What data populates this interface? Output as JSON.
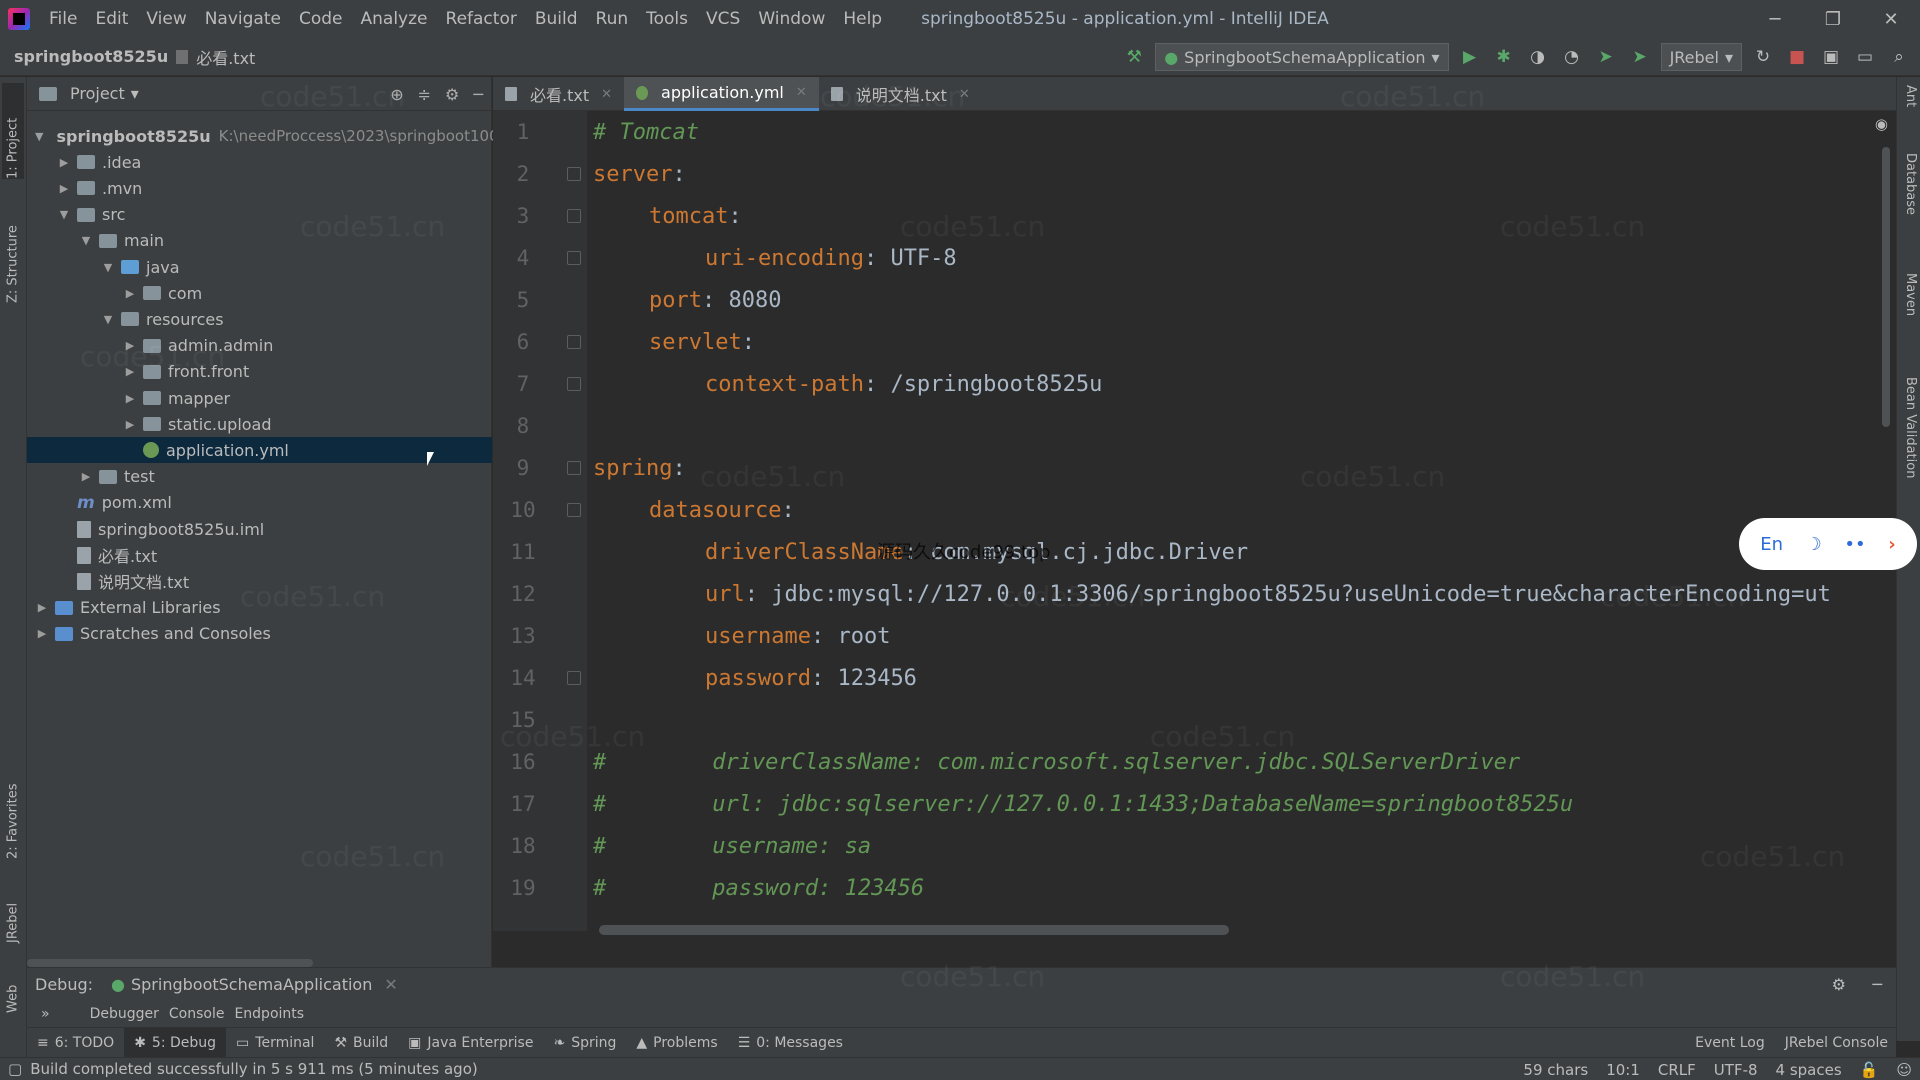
{
  "menu": [
    "File",
    "Edit",
    "View",
    "Navigate",
    "Code",
    "Analyze",
    "Refactor",
    "Build",
    "Run",
    "Tools",
    "VCS",
    "Window",
    "Help"
  ],
  "window_title": "springboot8525u - application.yml - IntelliJ IDEA",
  "breadcrumb": {
    "project": "springboot8525u",
    "file": "必看.txt"
  },
  "toolbar": {
    "run_config": "SpringbootSchemaApplication",
    "jrebel": "JRebel"
  },
  "left_tabs": [
    "1: Project",
    "Z: Structure",
    "2: Favorites",
    "JRebel",
    "Web"
  ],
  "right_tabs": [
    "Ant",
    "Database",
    "Maven",
    "Bean Validation"
  ],
  "project_panel": {
    "title": "Project",
    "root_path": "K:\\needProccess\\2023\\springboot100",
    "tree": [
      {
        "label": "springboot8525u",
        "depth": 0,
        "arrow": "▼",
        "icon": "folder"
      },
      {
        "label": ".idea",
        "depth": 1,
        "arrow": "▶",
        "icon": "folder"
      },
      {
        "label": ".mvn",
        "depth": 1,
        "arrow": "▶",
        "icon": "folder"
      },
      {
        "label": "src",
        "depth": 1,
        "arrow": "▼",
        "icon": "folder"
      },
      {
        "label": "main",
        "depth": 2,
        "arrow": "▼",
        "icon": "folder"
      },
      {
        "label": "java",
        "depth": 3,
        "arrow": "▼",
        "icon": "folder-blue"
      },
      {
        "label": "com",
        "depth": 4,
        "arrow": "▶",
        "icon": "folder"
      },
      {
        "label": "resources",
        "depth": 3,
        "arrow": "▼",
        "icon": "folder"
      },
      {
        "label": "admin.admin",
        "depth": 4,
        "arrow": "▶",
        "icon": "folder"
      },
      {
        "label": "front.front",
        "depth": 4,
        "arrow": "▶",
        "icon": "folder"
      },
      {
        "label": "mapper",
        "depth": 4,
        "arrow": "▶",
        "icon": "folder"
      },
      {
        "label": "static.upload",
        "depth": 4,
        "arrow": "▶",
        "icon": "folder"
      },
      {
        "label": "application.yml",
        "depth": 4,
        "arrow": "",
        "icon": "yml",
        "selected": true
      },
      {
        "label": "test",
        "depth": 2,
        "arrow": "▶",
        "icon": "folder"
      },
      {
        "label": "pom.xml",
        "depth": 1,
        "arrow": "",
        "icon": "maven"
      },
      {
        "label": "springboot8525u.iml",
        "depth": 1,
        "arrow": "",
        "icon": "file"
      },
      {
        "label": "必看.txt",
        "depth": 1,
        "arrow": "",
        "icon": "file"
      },
      {
        "label": "说明文档.txt",
        "depth": 1,
        "arrow": "",
        "icon": "file"
      },
      {
        "label": "External Libraries",
        "depth": 0,
        "arrow": "▶",
        "icon": "ext"
      },
      {
        "label": "Scratches and Consoles",
        "depth": 0,
        "arrow": "▶",
        "icon": "scratch"
      }
    ]
  },
  "editor_tabs": [
    {
      "label": "必看.txt",
      "active": false
    },
    {
      "label": "application.yml",
      "active": true
    },
    {
      "label": "说明文档.txt",
      "active": false
    }
  ],
  "code_lines": [
    {
      "n": "1",
      "indent": 0,
      "parts": [
        [
          "c",
          "# Tomcat"
        ]
      ]
    },
    {
      "n": "2",
      "indent": 0,
      "parts": [
        [
          "k",
          "server"
        ],
        [
          "v",
          ":"
        ]
      ]
    },
    {
      "n": "3",
      "indent": 1,
      "parts": [
        [
          "k",
          "tomcat"
        ],
        [
          "v",
          ":"
        ]
      ]
    },
    {
      "n": "4",
      "indent": 2,
      "parts": [
        [
          "k",
          "uri-encoding"
        ],
        [
          "v",
          ": UTF-8"
        ]
      ]
    },
    {
      "n": "5",
      "indent": 1,
      "parts": [
        [
          "k",
          "port"
        ],
        [
          "v",
          ": 8080"
        ]
      ]
    },
    {
      "n": "6",
      "indent": 1,
      "parts": [
        [
          "k",
          "servlet"
        ],
        [
          "v",
          ":"
        ]
      ]
    },
    {
      "n": "7",
      "indent": 2,
      "parts": [
        [
          "k",
          "context-path"
        ],
        [
          "v",
          ": /springboot8525u"
        ]
      ]
    },
    {
      "n": "8",
      "indent": 0,
      "parts": []
    },
    {
      "n": "9",
      "indent": 0,
      "parts": [
        [
          "k",
          "spring"
        ],
        [
          "v",
          ":"
        ]
      ]
    },
    {
      "n": "10",
      "indent": 1,
      "parts": [
        [
          "k",
          "datasource"
        ],
        [
          "v",
          ":"
        ]
      ]
    },
    {
      "n": "11",
      "indent": 2,
      "parts": [
        [
          "k",
          "driverClassName"
        ],
        [
          "v",
          ": com.mysql.cj.jdbc.Driver"
        ]
      ]
    },
    {
      "n": "12",
      "indent": 2,
      "parts": [
        [
          "k",
          "url"
        ],
        [
          "v",
          ": jdbc:mysql://127.0.0.1:3306/springboot8525u?useUnicode=true&characterEncoding=ut"
        ]
      ]
    },
    {
      "n": "13",
      "indent": 2,
      "parts": [
        [
          "k",
          "username"
        ],
        [
          "v",
          ": root"
        ]
      ]
    },
    {
      "n": "14",
      "indent": 2,
      "parts": [
        [
          "k",
          "password"
        ],
        [
          "v",
          ": 123456"
        ]
      ]
    },
    {
      "n": "15",
      "indent": 0,
      "parts": []
    },
    {
      "n": "16",
      "indent": 0,
      "parts": [
        [
          "c",
          "#        driverClassName: com.microsoft.sqlserver.jdbc.SQLServerDriver"
        ]
      ]
    },
    {
      "n": "17",
      "indent": 0,
      "parts": [
        [
          "c",
          "#        url: jdbc:sqlserver://127.0.0.1:1433;DatabaseName=springboot8525u"
        ]
      ]
    },
    {
      "n": "18",
      "indent": 0,
      "parts": [
        [
          "c",
          "#        username: sa"
        ]
      ]
    },
    {
      "n": "19",
      "indent": 0,
      "parts": [
        [
          "c",
          "#        password: 123456"
        ]
      ]
    }
  ],
  "debug": {
    "label": "Debug:",
    "config": "SpringbootSchemaApplication",
    "subtabs": [
      "Debugger",
      "Console",
      "Endpoints"
    ]
  },
  "tool_windows": [
    {
      "label": "6: TODO",
      "active": false
    },
    {
      "label": "5: Debug",
      "active": true
    },
    {
      "label": "Terminal",
      "active": false
    },
    {
      "label": "Build",
      "active": false
    },
    {
      "label": "Java Enterprise",
      "active": false
    },
    {
      "label": "Spring",
      "active": false
    },
    {
      "label": "Problems",
      "active": false
    },
    {
      "label": "0: Messages",
      "active": false
    }
  ],
  "tool_windows_right": [
    "Event Log",
    "JRebel Console"
  ],
  "status": {
    "message": "Build completed successfully in 5 s 911 ms (5 minutes ago)",
    "chars": "59 chars",
    "position": "10:1",
    "line_sep": "CRLF",
    "encoding": "UTF-8",
    "indent": "4 spaces"
  },
  "ime": {
    "lang": "En"
  },
  "overlay_text": "源码久久code99.top",
  "watermark_text": "code51.cn"
}
